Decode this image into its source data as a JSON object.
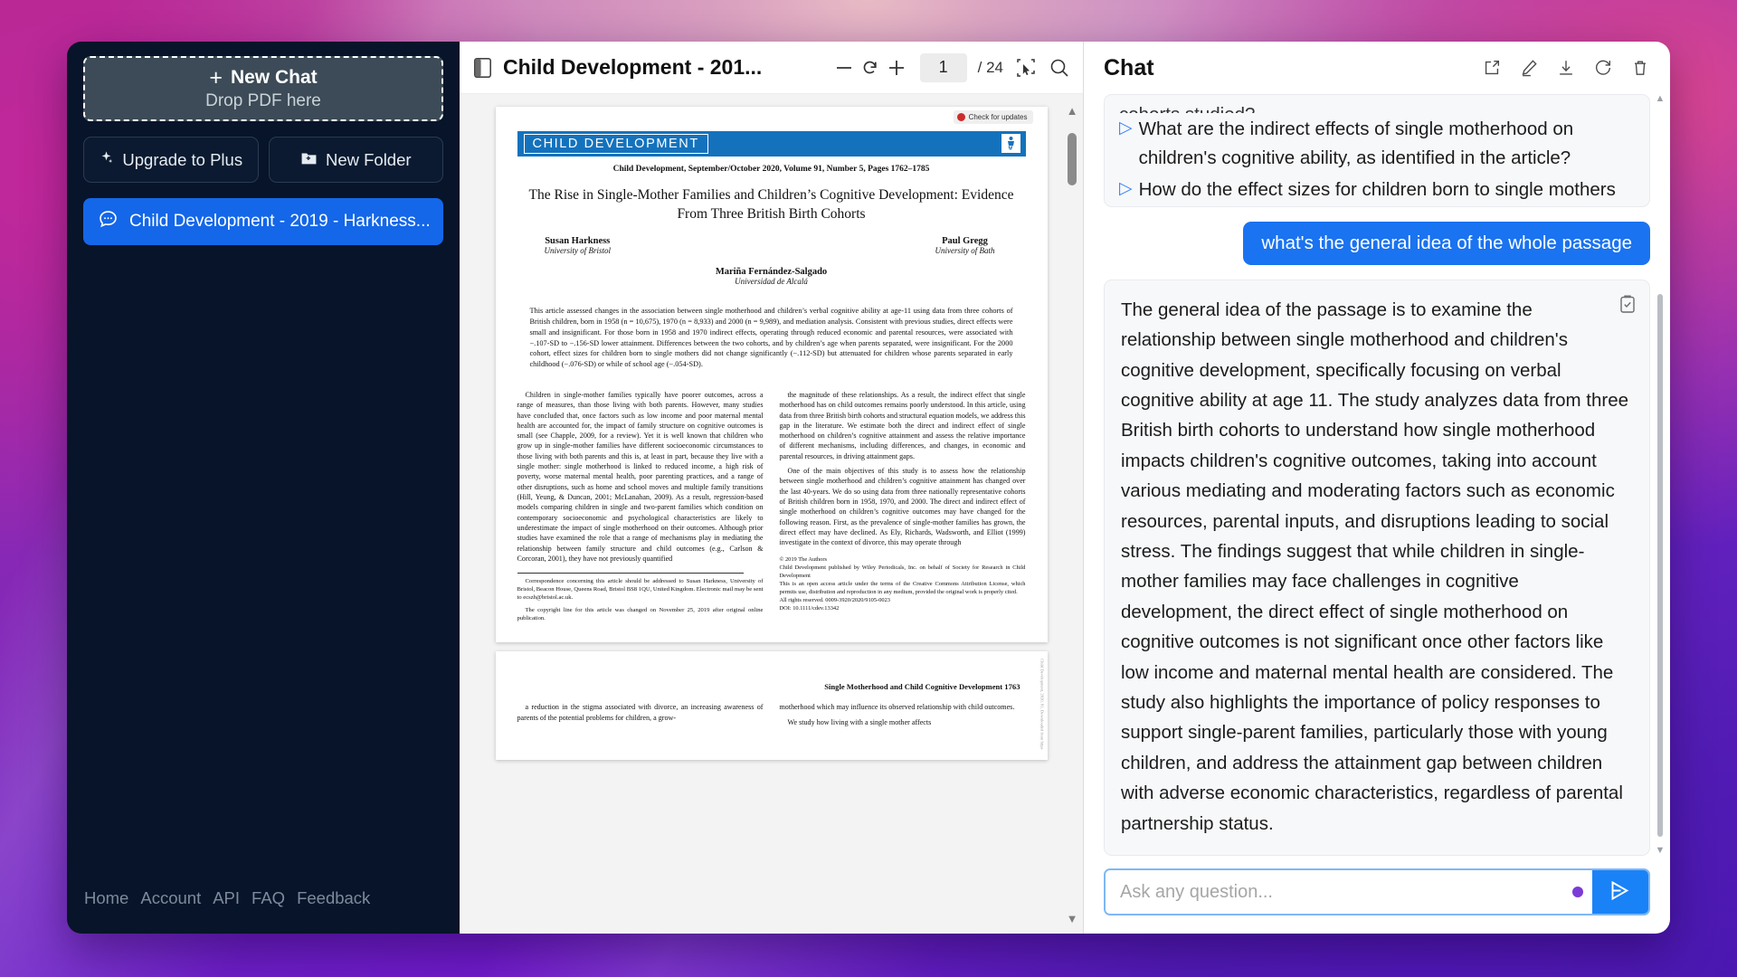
{
  "sidebar": {
    "new_chat": {
      "label": "New Chat",
      "sub": "Drop PDF here",
      "plus": "+"
    },
    "upgrade_label": "Upgrade to Plus",
    "new_folder_label": "New Folder",
    "chats": [
      {
        "label": "Child Development - 2019 - Harkness...",
        "active": true
      }
    ],
    "footer_links": [
      "Home",
      "Account",
      "API",
      "FAQ",
      "Feedback"
    ]
  },
  "pdf": {
    "title": "Child Development - 201...",
    "page_current": "1",
    "page_total": "/ 24",
    "zoom_out": "−",
    "rotate": "↺",
    "zoom_in": "+",
    "check_updates": "Check for updates",
    "document": {
      "banner": "CHILD DEVELOPMENT",
      "journal_line": "Child Development, September/October 2020, Volume 91, Number 5, Pages 1762–1785",
      "title": "The Rise in Single-Mother Families and Children’s Cognitive Development: Evidence From Three British Birth Cohorts",
      "authors": [
        {
          "name": "Susan Harkness",
          "affiliation": "University of Bristol"
        },
        {
          "name": "Paul Gregg",
          "affiliation": "University of Bath"
        },
        {
          "name": "Mariña Fernández-Salgado",
          "affiliation": "Universidad de Alcalá"
        }
      ],
      "abstract": "This article assessed changes in the association between single motherhood and children’s verbal cognitive ability at age-11 using data from three cohorts of British children, born in 1958 (n = 10,675), 1970 (n = 8,933) and 2000 (n = 9,989), and mediation analysis. Consistent with previous studies, direct effects were small and insignificant. For those born in 1958 and 1970 indirect effects, operating through reduced economic and parental resources, were associated with −.107-SD to −.156-SD lower attainment. Differences between the two cohorts, and by children’s age when parents separated, were insignificant. For the 2000 cohort, effect sizes for children born to single mothers did not change significantly (−.112-SD) but attenuated for children whose parents separated in early childhood (−.076-SD) or while of school age (−.054-SD).",
      "col_left_1": "Children in single-mother families typically have poorer outcomes, across a range of measures, than those living with both parents. However, many studies have concluded that, once factors such as low income and poor maternal mental health are accounted for, the impact of family structure on cognitive outcomes is small (see Chapple, 2009, for a review). Yet it is well known that children who grow up in single-mother families have different socioeconomic circumstances to those living with both parents and this is, at least in part, because they live with a single mother: single motherhood is linked to reduced income, a high risk of poverty, worse maternal mental health, poor parenting practices, and a range of other disruptions, such as home and school moves and multiple family transitions (Hill, Yeung, & Duncan, 2001; McLanahan, 2009). As a result, regression-based models comparing children in single and two-parent families which condition on contemporary socioeconomic and psychological characteristics are likely to underestimate the impact of single motherhood on their outcomes. Although prior studies have examined the role that a range of mechanisms play in mediating the relationship between family structure and child outcomes (e.g., Carlson & Corcoran, 2001), they have not previously quantified",
      "correspondence": "Correspondence concerning this article should be addressed to Susan Harkness, University of Bristol, Beacon House, Queens Road, Bristol BS8 1QU, United Kingdom. Electronic mail may be sent to ecszh@bristol.ac.uk.",
      "correction": "The copyright line for this article was changed on November 25, 2019 after original online publication.",
      "col_right_1": "the magnitude of these relationships. As a result, the indirect effect that single motherhood has on child outcomes remains poorly understood. In this article, using data from three British birth cohorts and structural equation models, we address this gap in the literature. We estimate both the direct and indirect effect of single motherhood on children’s cognitive attainment and assess the relative importance of different mechanisms, including differences, and changes, in economic and parental resources, in driving attainment gaps.",
      "col_right_2": "One of the main objectives of this study is to assess how the relationship between single motherhood and children’s cognitive attainment has changed over the last 40-years. We do so using data from three nationally representative cohorts of British children born in 1958, 1970, and 2000. The direct and indirect effect of single motherhood on children’s cognitive outcomes may have changed for the following reason. First, as the prevalence of single-mother families has grown, the direct effect may have declined. As Ely, Richards, Wadsworth, and Elliot (1999) investigate in the context of divorce, this may operate through",
      "copyright": [
        "© 2019 The Authors",
        "Child Development published by Wiley Periodicals, Inc. on behalf of Society for Research in Child Development",
        "This is an open access article under the terms of the Creative Commons Attribution License, which permits use, distribution and reproduction in any medium, provided the original work is properly cited.",
        "All rights reserved. 0009-3920/2020/9105-0023",
        "DOI: 10.1111/cdev.13342"
      ],
      "page2_header": "Single Motherhood and Child Cognitive Development    1763",
      "page2_col_left": "a reduction in the stigma associated with divorce, an increasing awareness of parents of the potential problems for children, a grow-",
      "page2_col_right_1": "motherhood which may influence its observed relationship with child outcomes.",
      "page2_col_right_2": "We study how living with a single mother affects",
      "side_text": "Child Development, 2020, 91, Downloaded from https"
    }
  },
  "chat": {
    "title": "Chat",
    "actions": [
      "share-icon",
      "edit-icon",
      "download-icon",
      "refresh-icon",
      "trash-icon"
    ],
    "clipped_top": "cohorts studied?",
    "suggestions": [
      "What are the indirect effects of single motherhood on children's cognitive ability, as identified in the article?",
      "How do the effect sizes for children born to single mothers compare to those whose parents separated in early childhood or while of school age in the 2000 cohort?"
    ],
    "user_message": "what's the general idea of the whole passage",
    "assistant_message": "The general idea of the passage is to examine the relationship between single motherhood and children's cognitive development, specifically focusing on verbal cognitive ability at age 11. The study analyzes data from three British birth cohorts to understand how single motherhood impacts children's cognitive outcomes, taking into account various mediating and moderating factors such as economic resources, parental inputs, and disruptions leading to social stress. The findings suggest that while children in single-mother families may face challenges in cognitive development, the direct effect of single motherhood on cognitive outcomes is not significant once other factors like low income and maternal mental health are considered. The study also highlights the importance of policy responses to support single-parent families, particularly those with young children, and address the attainment gap between children with adverse economic characteristics, regardless of parental partnership status.",
    "input_placeholder": "Ask any question...",
    "input_value": ""
  },
  "colors": {
    "accent_blue": "#1a73f0",
    "sidebar_bg": "#071429",
    "send_blue": "#1a82f7"
  }
}
